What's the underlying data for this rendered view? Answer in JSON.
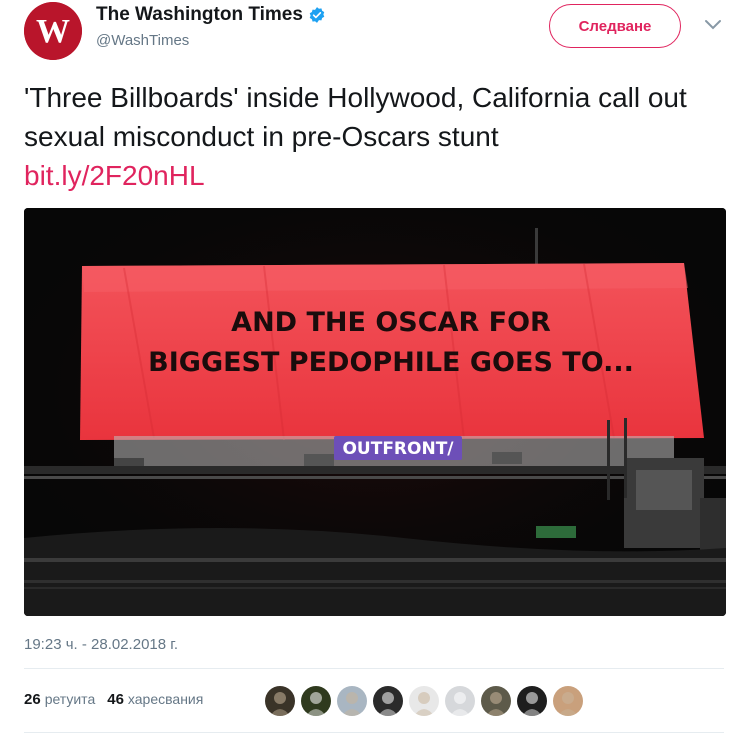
{
  "account": {
    "name": "The Washington Times",
    "handle": "@WashTimes",
    "avatar_letter": "W",
    "verified": true
  },
  "follow_button": {
    "label": "Следване"
  },
  "tweet": {
    "text": "'Three Billboards' inside Hollywood, California call out sexual misconduct in pre-Oscars stunt",
    "link": "bit.ly/2F20nHL"
  },
  "billboard": {
    "line1": "AND THE OSCAR FOR",
    "line2": "BIGGEST PEDOPHILE GOES TO...",
    "brand": "OUTFRONT/"
  },
  "timestamp": "19:23 ч. - 28.02.2018 г.",
  "stats": {
    "retweets_count": "26",
    "retweets_label": "ретуита",
    "likes_count": "46",
    "likes_label": "харесвания"
  },
  "liker_avatars": [
    {
      "name": "liker-1",
      "color": "#3a3328"
    },
    {
      "name": "liker-2",
      "color": "#2f3a1e"
    },
    {
      "name": "liker-3",
      "color": "#a9b6c2"
    },
    {
      "name": "liker-4",
      "color": "#2a2a2a"
    },
    {
      "name": "liker-5",
      "color": "#e8e8e8"
    },
    {
      "name": "liker-6",
      "color": "#d6d8db"
    },
    {
      "name": "liker-7",
      "color": "#5d5a4a"
    },
    {
      "name": "liker-8",
      "color": "#1e1e1e"
    },
    {
      "name": "liker-9",
      "color": "#c9a07c"
    }
  ],
  "colors": {
    "accent": "#e0245e",
    "verified": "#1da1f2",
    "brand_red": "#b9152b",
    "billboard_red": "#f2444c"
  }
}
